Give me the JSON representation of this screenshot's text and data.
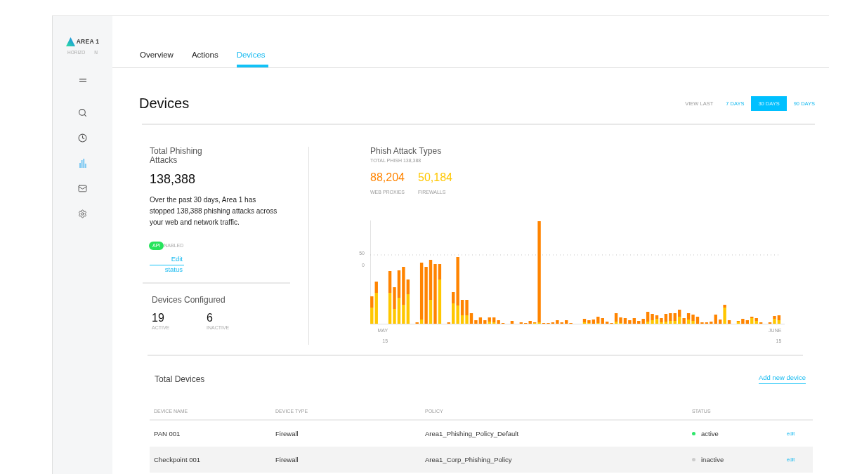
{
  "sidebar": {
    "brand": "AREA 1",
    "subtitle": "HORIZO N",
    "nav_items": [
      {
        "selected": false
      },
      {
        "selected": false
      },
      {
        "selected": true
      },
      {
        "selected": false
      },
      {
        "selected": false
      }
    ]
  },
  "tabs": [
    {
      "label": "Overview",
      "selected": false
    },
    {
      "label": "Actions",
      "selected": false
    },
    {
      "label": "Devices",
      "selected": true
    }
  ],
  "page": {
    "title": "Devices",
    "range": {
      "label": "VIEW LAST",
      "options": [
        {
          "label": "7 DAYS",
          "selected": false
        },
        {
          "label": "30 DAYS",
          "selected": true
        },
        {
          "label": "90 DAYS",
          "selected": false
        }
      ]
    }
  },
  "phishing_summary": {
    "title": "Total Phishing Attacks",
    "value": "138,388",
    "description": "Over the past 30 days, Area 1 has stopped 138,388 phishing attacks across your web and network traffic.",
    "api_badge": "API",
    "api_status": "NABLED",
    "edit_link": "Edit status"
  },
  "devices_configured": {
    "title": "Devices Configured",
    "counts": [
      {
        "value": "19",
        "label": "ACTIVE"
      },
      {
        "value": "6",
        "label": "INACTIVE"
      }
    ]
  },
  "attack_types": {
    "title": "Phish Attack Types",
    "subtitle": "TOTAL PHISH 138,388",
    "legend": [
      {
        "value": "88,204",
        "label": "WEB PROXIES",
        "color": "#ff8400"
      },
      {
        "value": "50,184",
        "label": "FIREWALLS",
        "color": "#ffc700"
      }
    ],
    "y_axis_labels": [
      "50",
      "0"
    ],
    "x_axis_labels": [
      "MAY 15",
      "JUNE 15"
    ]
  },
  "devices": {
    "title": "Total Devices",
    "add_link": "Add new device",
    "columns": [
      "DEVICE NAME",
      "DEVICE TYPE",
      "POLICY",
      "STATUS"
    ],
    "rows": [
      {
        "name": "PAN 001",
        "type": "Firewall",
        "policy": "Area1_Phishing_Policy_Default",
        "status": "active",
        "color": "#2ee66b",
        "action": "edit",
        "selected": false
      },
      {
        "name": "Checkpoint 001",
        "type": "Firewall",
        "policy": "Area1_Corp_Phishing_Policy",
        "status": "inactive",
        "color": "#cccccc",
        "action": "edit",
        "selected": true
      }
    ]
  }
}
